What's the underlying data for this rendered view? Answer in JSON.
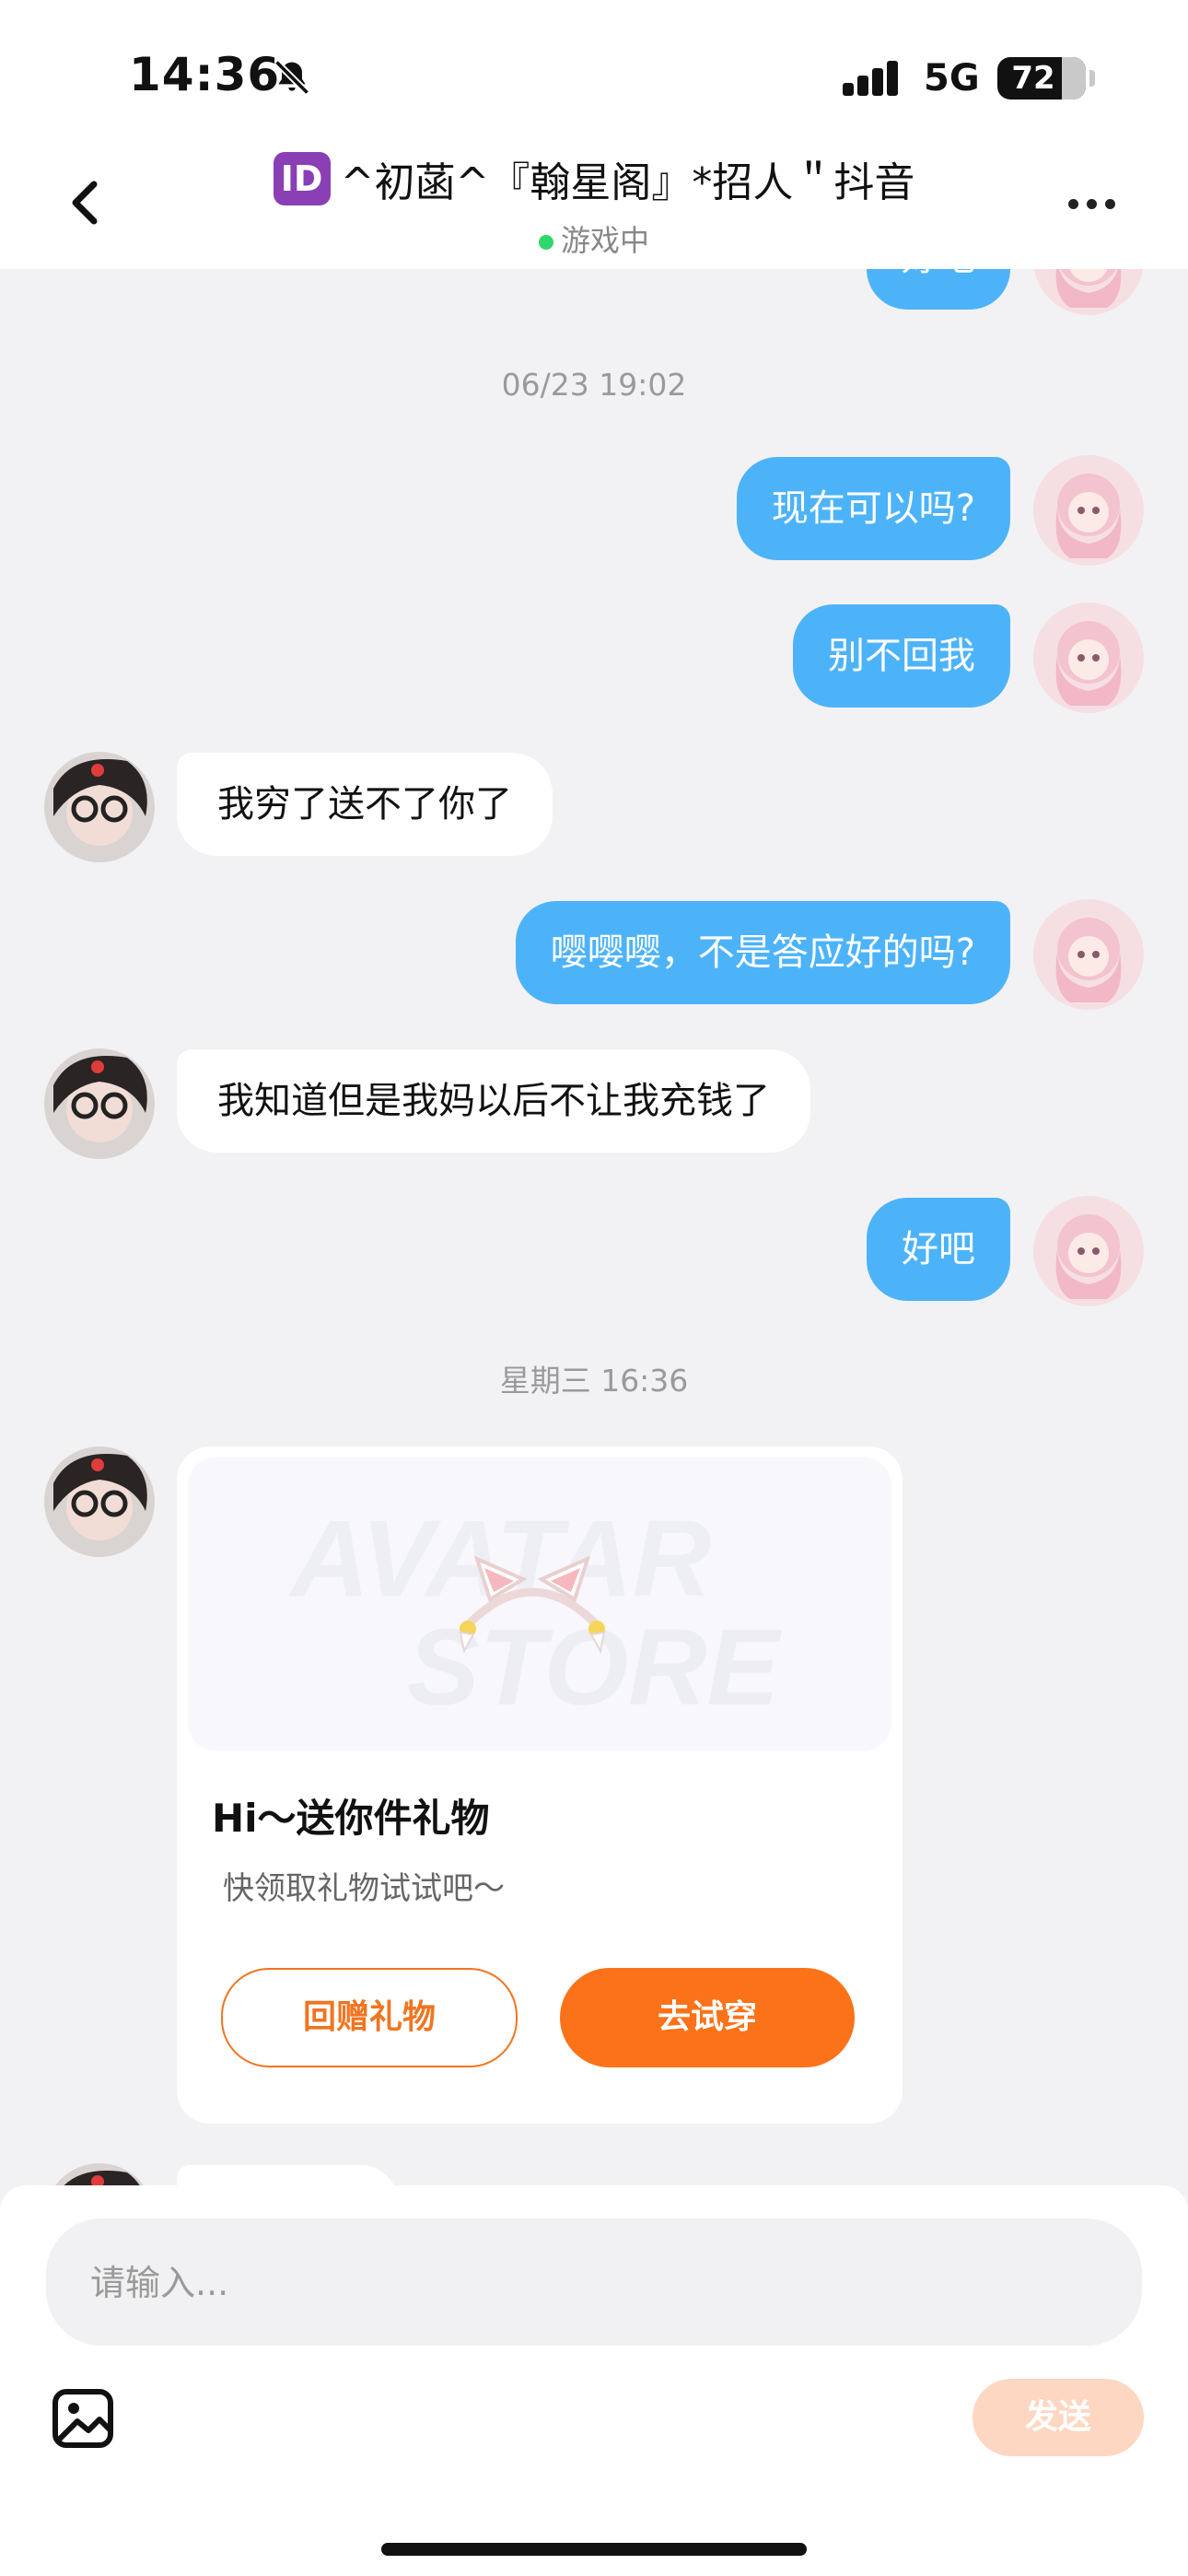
{
  "status": {
    "time": "14:36",
    "network": "5G",
    "battery": "72",
    "battery_level_pct": 72
  },
  "header": {
    "badge": "ID",
    "title": "^初菡^『翰星阁』*招人＂抖音",
    "status": "游戏中"
  },
  "messages": {
    "prev_partial": "好吧",
    "ts1": "06/23 19:02",
    "m1": "现在可以吗?",
    "m2": "别不回我",
    "m3": "我穷了送不了你了",
    "m4": "嘤嘤嘤，不是答应好的吗?",
    "m5": "我知道但是我妈以后不让我充钱了",
    "m6": "好吧",
    "ts2": "星期三 16:36"
  },
  "gift_card": {
    "banner_text_1": "AVATAR",
    "banner_text_2": "STORE",
    "title": "Hi～送你件礼物",
    "subtitle": "快领取礼物试试吧～",
    "return_gift": "回赠礼物",
    "try_on": "去试穿"
  },
  "composer": {
    "placeholder": "请输入...",
    "send": "发送"
  },
  "icons": [
    "mute-bell-icon",
    "signal-icon",
    "back-chevron-icon",
    "more-dots-icon",
    "image-icon",
    "cat-ear-headband-icon"
  ],
  "colors": {
    "me_bubble": "#4db3f9",
    "accent_orange": "#fb7218",
    "online_dot": "#2fd66a",
    "send_disabled": "#fdd7c2"
  }
}
